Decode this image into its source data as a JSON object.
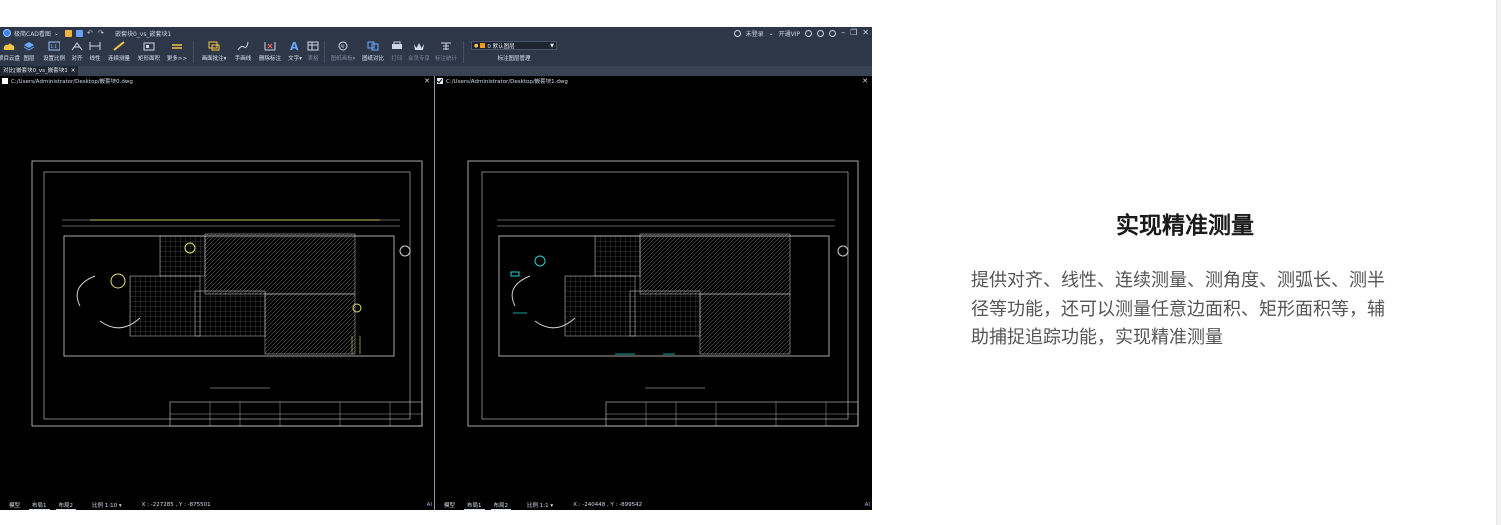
{
  "cad_window": {
    "app_title": "极简CAD看图",
    "document_title": "嵌套块0_vs_嵌套块1",
    "login": "未登录",
    "vip": "开通VIP",
    "ribbon": [
      {
        "label": "项目云盘",
        "icon": "cloud-icon"
      },
      {
        "label": "图层",
        "icon": "layers-icon"
      },
      {
        "label": "设置比例",
        "icon": "scale-icon"
      },
      {
        "label": "对齐",
        "icon": "align-icon"
      },
      {
        "label": "线性",
        "icon": "linear-icon"
      },
      {
        "label": "连续测量",
        "icon": "continuous-measure-icon"
      },
      {
        "label": "矩形面积",
        "icon": "rect-area-icon"
      },
      {
        "label": "更多>>",
        "icon": "more-icon"
      },
      {
        "label": "画面批注▾",
        "icon": "annotate-icon"
      },
      {
        "label": "手画线",
        "icon": "freehand-icon"
      },
      {
        "label": "删除标注",
        "icon": "delete-annotation-icon"
      },
      {
        "label": "文字▾",
        "icon": "text-icon"
      },
      {
        "label": "表格",
        "icon": "table-icon",
        "disabled": true
      },
      {
        "label": "图纸画板▾",
        "icon": "drawing-board-icon",
        "disabled": true
      },
      {
        "label": "图纸对比",
        "icon": "compare-icon"
      },
      {
        "label": "打印",
        "icon": "print-icon",
        "disabled": true
      },
      {
        "label": "会员专享",
        "icon": "vip-icon",
        "disabled": true
      },
      {
        "label": "标注统计",
        "icon": "stats-icon",
        "disabled": true
      }
    ],
    "layer_select": "0 默认图层",
    "layer_manage": "标注图层管理",
    "doc_tab": "对比[嵌套块0_vs_嵌套块1",
    "viewports": [
      {
        "path": "C:/Users/Administrator/Desktop/嵌套块0.dwg",
        "checked": false,
        "scale": "比例 1:10 ▾",
        "coords": "X : -227285 , Y : -875501"
      },
      {
        "path": "C:/Users/Administrator/Desktop/嵌套块1.dwg",
        "checked": true,
        "scale": "比例 1:1 ▾",
        "coords": "X : -240448 , Y : -899542"
      }
    ],
    "layout_tabs": [
      "模型",
      "布局1",
      "布局2"
    ],
    "ai_label": "AI"
  },
  "feature": {
    "title": "实现精准测量",
    "description": "提供对齐、线性、连续测量、测角度、测弧长、测半径等功能，还可以测量任意边面积、矩形面积等，辅助捕捉追踪功能，实现精准测量"
  }
}
